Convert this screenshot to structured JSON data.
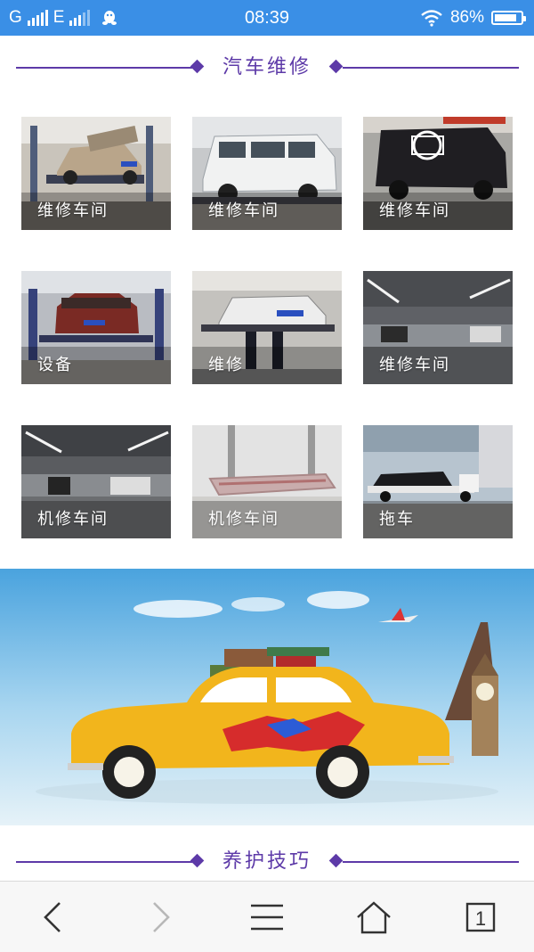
{
  "status_bar": {
    "carrier_1": "G",
    "carrier_2": "E",
    "time": "08:39",
    "battery_percent": "86%",
    "battery_level": 0.86,
    "icons": [
      "signal-icon",
      "qq-penguin-icon",
      "wifi-icon",
      "battery-icon"
    ]
  },
  "repair_section": {
    "title": "汽车维修",
    "tiles": [
      {
        "label": "维修车间",
        "scene": "car on lift"
      },
      {
        "label": "维修车间",
        "scene": "white van"
      },
      {
        "label": "维修车间",
        "scene": "SF van"
      },
      {
        "label": "设备",
        "scene": "red car on lift"
      },
      {
        "label": "维修",
        "scene": "white car lifted"
      },
      {
        "label": "维修车间",
        "scene": "workshop hall"
      },
      {
        "label": "机修车间",
        "scene": "workshop hall"
      },
      {
        "label": "机修车间",
        "scene": "frame machine"
      },
      {
        "label": "拖车",
        "scene": "tow truck"
      }
    ]
  },
  "banner": {
    "description_icon": "travel-car-banner",
    "colors": {
      "sky": "#7fc3ea",
      "car": "#f2b51c"
    }
  },
  "care_section": {
    "title": "养护技巧"
  },
  "bottom_nav": {
    "icons": [
      "back-icon",
      "forward-icon",
      "menu-icon",
      "home-icon",
      "tabs-icon"
    ],
    "tab_count": "1"
  },
  "theme": {
    "accent": "#5d3aa8",
    "status_bar": "#3a8fe6"
  }
}
